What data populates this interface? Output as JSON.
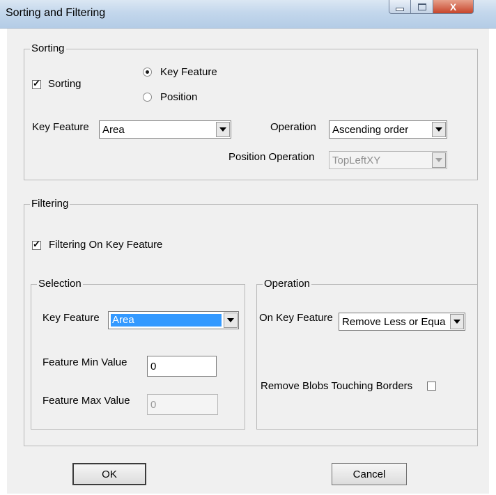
{
  "window": {
    "title": "Sorting and Filtering",
    "close_glyph": "X"
  },
  "sorting": {
    "group_label": "Sorting",
    "checkbox_label": "Sorting",
    "checkbox_checked": true,
    "radio_key_feature": "Key Feature",
    "radio_position": "Position",
    "radio_selected": "Key Feature",
    "key_feature_label": "Key Feature",
    "key_feature_value": "Area",
    "operation_label": "Operation",
    "operation_value": "Ascending order",
    "position_operation_label": "Position Operation",
    "position_operation_value": "TopLeftXY"
  },
  "filtering": {
    "group_label": "Filtering",
    "checkbox_label": "Filtering On Key Feature",
    "checkbox_checked": true,
    "selection": {
      "group_label": "Selection",
      "key_feature_label": "Key Feature",
      "key_feature_value": "Area",
      "min_label": "Feature Min Value",
      "min_value": "0",
      "max_label": "Feature Max Value",
      "max_value": "0"
    },
    "operation": {
      "group_label": "Operation",
      "on_key_feature_label": "On Key Feature",
      "on_key_feature_value": "Remove Less or Equa",
      "remove_blobs_label": "Remove Blobs Touching Borders",
      "remove_blobs_checked": false
    }
  },
  "buttons": {
    "ok": "OK",
    "cancel": "Cancel"
  }
}
